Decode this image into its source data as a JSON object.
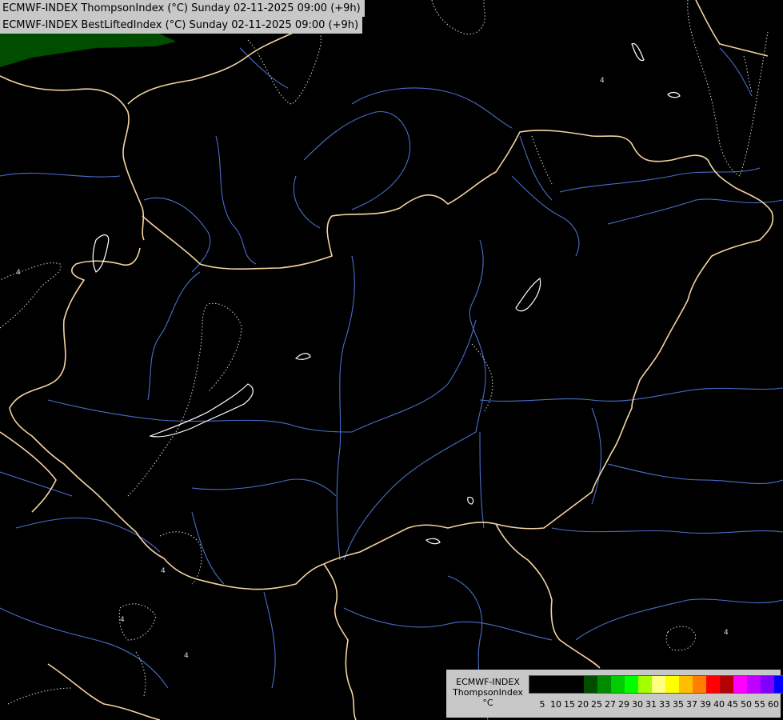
{
  "titles": {
    "line1": "ECMWF-INDEX ThompsonIndex (°C) Sunday 02-11-2025 09:00 (+9h)",
    "line2": "ECMWF-INDEX BestLiftedIndex (°C) Sunday 02-11-2025 09:00 (+9h)"
  },
  "legend": {
    "label_line1": "ECMWF-INDEX",
    "label_line2": "ThompsonIndex",
    "label_line3": "°C",
    "ticks": [
      "5",
      "10",
      "15",
      "20",
      "25",
      "27",
      "29",
      "30",
      "31",
      "33",
      "35",
      "37",
      "39",
      "40",
      "45",
      "50",
      "55",
      "60"
    ],
    "colors": [
      "#000000",
      "#000000",
      "#000000",
      "#000000",
      "#004d00",
      "#008a00",
      "#00cc00",
      "#00ff00",
      "#a6ff00",
      "#ffff80",
      "#ffff00",
      "#ffbf00",
      "#ff8000",
      "#ff0000",
      "#b30000",
      "#ff00ff",
      "#c000ff",
      "#8000ff",
      "#0000ff"
    ]
  },
  "contour_labels": [
    "4",
    "4",
    "4",
    "4",
    "4",
    "4"
  ],
  "colors": {
    "background": "#000000",
    "border": "#f5d3a0",
    "river": "#4a6ec8",
    "contour_white": "#ffffff",
    "green_area": "#004d00"
  }
}
